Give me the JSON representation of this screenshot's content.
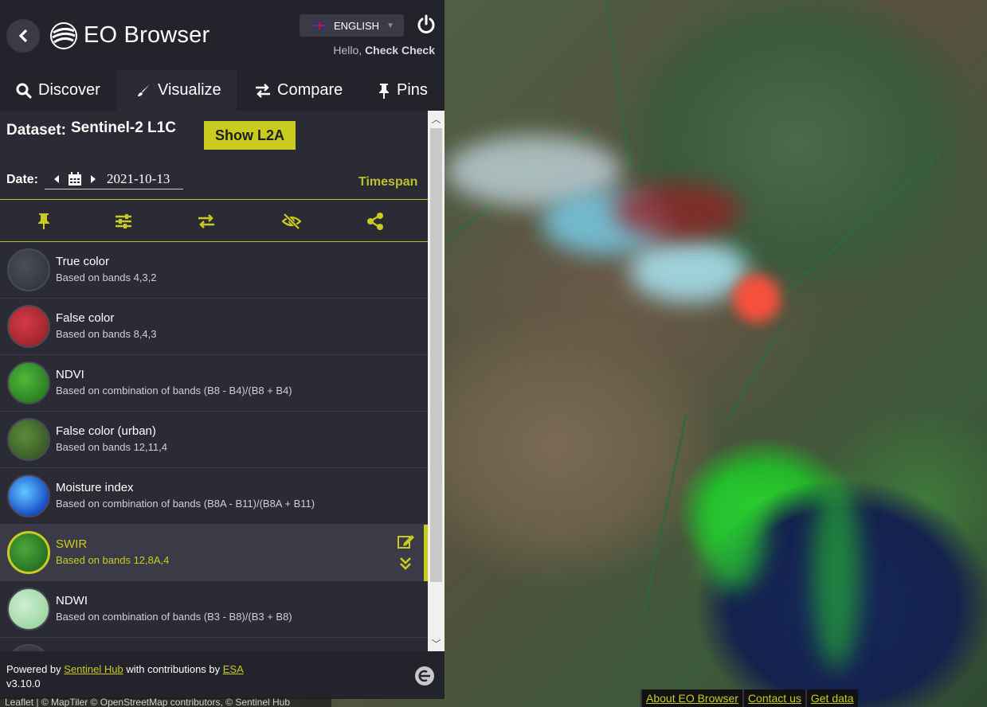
{
  "app": {
    "title": "EO Browser"
  },
  "header": {
    "language": "ENGLISH",
    "hello_prefix": "Hello,",
    "user_name": "Check Check"
  },
  "tabs": [
    {
      "label": "Discover",
      "icon": "search-icon",
      "active": false
    },
    {
      "label": "Visualize",
      "icon": "brush-icon",
      "active": true
    },
    {
      "label": "Compare",
      "icon": "compare-icon",
      "active": false
    },
    {
      "label": "Pins",
      "icon": "pin-icon",
      "active": false
    }
  ],
  "dataset": {
    "label": "Dataset:",
    "name": "Sentinel-2 L1C",
    "show_l2a_label": "Show L2A"
  },
  "date": {
    "label": "Date:",
    "value": "2021-10-13",
    "timespan_label": "Timespan"
  },
  "toolbar": {
    "icons": [
      "pin-icon",
      "sliders-icon",
      "swap-icon",
      "eye-slash-icon",
      "share-icon"
    ]
  },
  "layers": [
    {
      "name": "True color",
      "desc": "Based on bands 4,3,2",
      "selected": false
    },
    {
      "name": "False color",
      "desc": "Based on bands 8,4,3",
      "selected": false
    },
    {
      "name": "NDVI",
      "desc": "Based on combination of bands (B8 - B4)/(B8 + B4)",
      "selected": false
    },
    {
      "name": "False color (urban)",
      "desc": "Based on bands 12,11,4",
      "selected": false
    },
    {
      "name": "Moisture index",
      "desc": "Based on combination of bands (B8A - B11)/(B8A + B11)",
      "selected": false
    },
    {
      "name": "SWIR",
      "desc": "Based on bands 12,8A,4",
      "selected": true
    },
    {
      "name": "NDWI",
      "desc": "Based on combination of bands (B3 - B8)/(B3 + B8)",
      "selected": false
    }
  ],
  "footer": {
    "powered_prefix": "Powered by",
    "sentinel_hub": "Sentinel Hub",
    "contributions": "with contributions by",
    "esa": "ESA",
    "version": "v3.10.0"
  },
  "map": {
    "attribution": "Leaflet | © MapTiler © OpenStreetMap contributors, © Sentinel Hub",
    "links": [
      "About EO Browser",
      "Contact us",
      "Get data"
    ]
  },
  "colors": {
    "accent": "#c9cc1e",
    "panel": "#2b2b35",
    "header": "#23232b"
  }
}
